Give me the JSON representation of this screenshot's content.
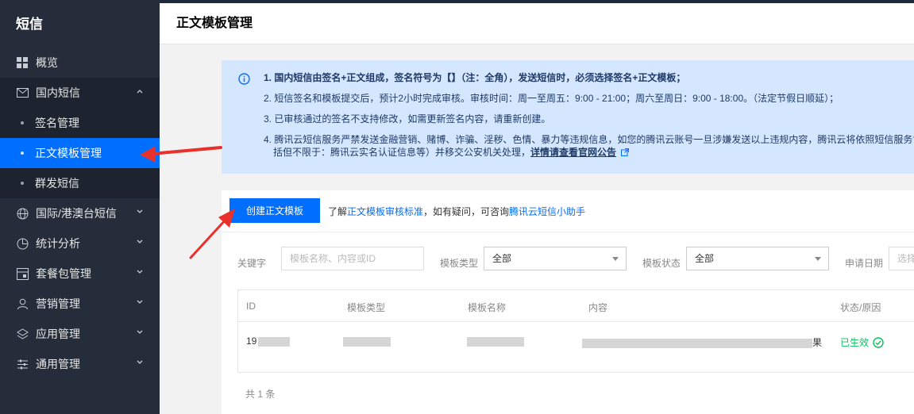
{
  "sidebar": {
    "brand": "短信",
    "items": [
      {
        "label": "概览",
        "icon": "grid-icon"
      },
      {
        "label": "国内短信",
        "icon": "mail-icon",
        "expanded": true,
        "children": [
          {
            "label": "签名管理"
          },
          {
            "label": "正文模板管理",
            "active": true
          },
          {
            "label": "群发短信"
          }
        ]
      },
      {
        "label": "国际/港澳台短信",
        "icon": "globe-icon"
      },
      {
        "label": "统计分析",
        "icon": "pie-icon"
      },
      {
        "label": "套餐包管理",
        "icon": "package-icon"
      },
      {
        "label": "营销管理",
        "icon": "user-icon"
      },
      {
        "label": "应用管理",
        "icon": "layers-icon"
      },
      {
        "label": "通用管理",
        "icon": "sliders-icon"
      }
    ]
  },
  "header": {
    "title": "正文模板管理"
  },
  "notice": {
    "line1": "1. 国内短信由签名+正文组成，签名符号为【】（注：全角），发送短信时，必须选择签名+正文模板；",
    "line2": "2. 短信签名和模板提交后，预计2小时完成审核。审核时间：周一至周五：9:00 - 21:00；周六至周日：9:00 - 18:00。（法定节假日顺延）；",
    "line3": "3. 已审核通过的签名不支持修改，如需更新签名内容，请重新创建。",
    "line4": "4. 腾讯云短信服务严禁发送金融营销、赌博、诈骗、淫秽、色情、暴力等违规信息，如您的腾讯云账号一旦涉嫌发送以上违规内容，腾讯云将依照短信服务协",
    "line4b": "括但不限于：腾讯云实名认证信息等）并移交公安机关处理，",
    "line4_link": "详情请查看官网公告"
  },
  "toolbar": {
    "create_label": "创建正文模板",
    "hint_prefix": "了解",
    "hint_link1": "正文模板审核标准",
    "hint_middle": "，如有疑问，可咨询",
    "hint_link2": "腾讯云短信小助手"
  },
  "filters": {
    "keyword_label": "关键字",
    "keyword_placeholder": "模板名称、内容或ID",
    "type_label": "模板类型",
    "type_value": "全部",
    "status_label": "模板状态",
    "status_value": "全部",
    "date_label": "申请日期",
    "date_placeholder": "选择"
  },
  "table": {
    "columns": [
      "ID",
      "模板类型",
      "模板名称",
      "内容",
      "状态/原因"
    ],
    "rows": [
      {
        "id": "19",
        "content_tail": "果",
        "status": "已生效"
      }
    ]
  },
  "footer": {
    "count_text": "共 1 条"
  },
  "colors": {
    "sidebar_bg": "#262d3a",
    "accent": "#006eff",
    "notice_bg": "#d5e7ff",
    "success": "#0abf5b",
    "arrow": "#e8312a"
  }
}
